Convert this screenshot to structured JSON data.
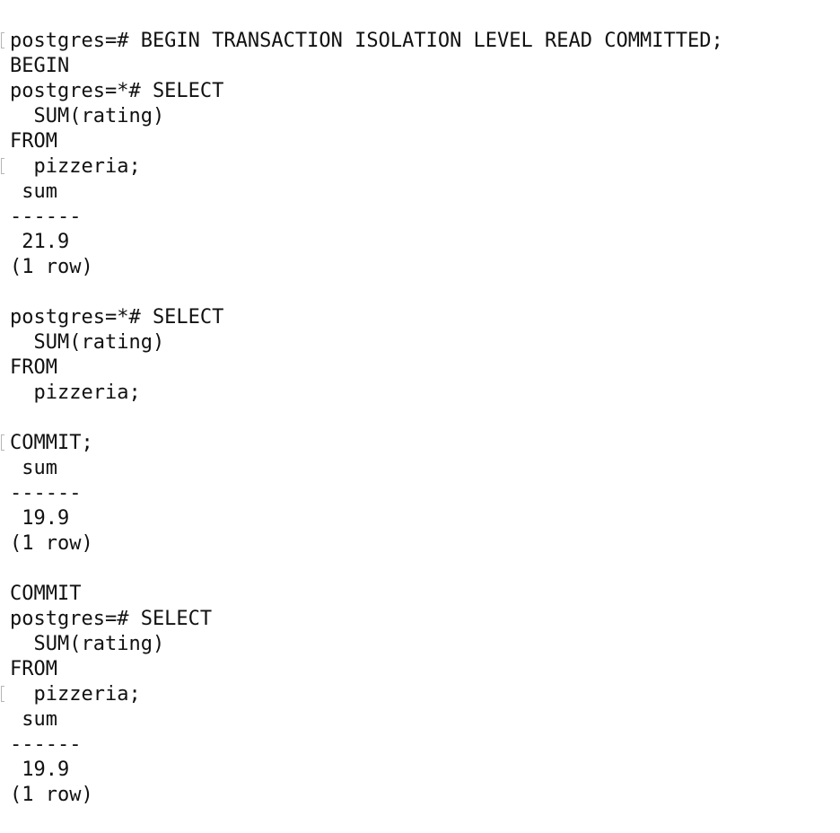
{
  "terminal": {
    "lines": [
      "postgres=# BEGIN TRANSACTION ISOLATION LEVEL READ COMMITTED;",
      "BEGIN",
      "postgres=*# SELECT",
      "  SUM(rating)",
      "FROM",
      "  pizzeria;",
      " sum",
      "------",
      " 21.9",
      "(1 row)",
      "",
      "postgres=*# SELECT",
      "  SUM(rating)",
      "FROM",
      "  pizzeria;",
      "",
      "COMMIT;",
      " sum",
      "------",
      " 19.9",
      "(1 row)",
      "",
      "COMMIT",
      "postgres=# SELECT",
      "  SUM(rating)",
      "FROM",
      "  pizzeria;",
      " sum",
      "------",
      " 19.9",
      "(1 row)"
    ]
  }
}
